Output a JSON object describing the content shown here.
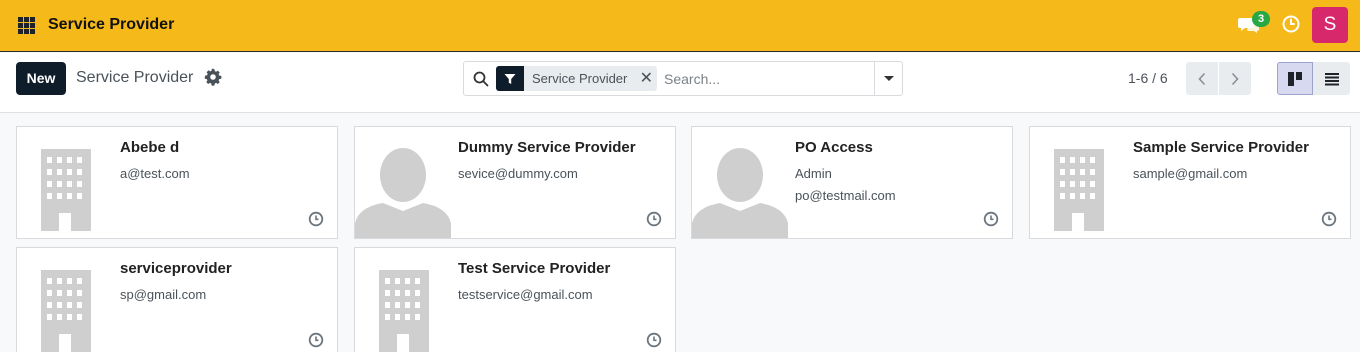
{
  "topbar": {
    "title": "Service Provider",
    "chat_count": "3",
    "avatar_letter": "S",
    "color": "#f5b919"
  },
  "control": {
    "new_label": "New",
    "breadcrumb": "Service Provider",
    "search": {
      "facet": "Service Provider",
      "facet_remove": "✕",
      "placeholder": "Search..."
    },
    "pager": "1-6 / 6"
  },
  "cards": [
    {
      "name": "Abebe d",
      "line1": "a@test.com",
      "line2": "",
      "image": "building-placeholder"
    },
    {
      "name": "Dummy Service Provider",
      "line1": "sevice@dummy.com",
      "line2": "",
      "image": "person-placeholder"
    },
    {
      "name": "PO Access",
      "line1": "Admin",
      "line2": "po@testmail.com",
      "image": "person-placeholder"
    },
    {
      "name": "Sample Service Provider",
      "line1": "sample@gmail.com",
      "line2": "",
      "image": "building-placeholder"
    },
    {
      "name": "serviceprovider",
      "line1": "sp@gmail.com",
      "line2": "",
      "image": "building-placeholder"
    },
    {
      "name": "Test Service Provider",
      "line1": "testservice@gmail.com",
      "line2": "",
      "image": "building-placeholder"
    }
  ]
}
